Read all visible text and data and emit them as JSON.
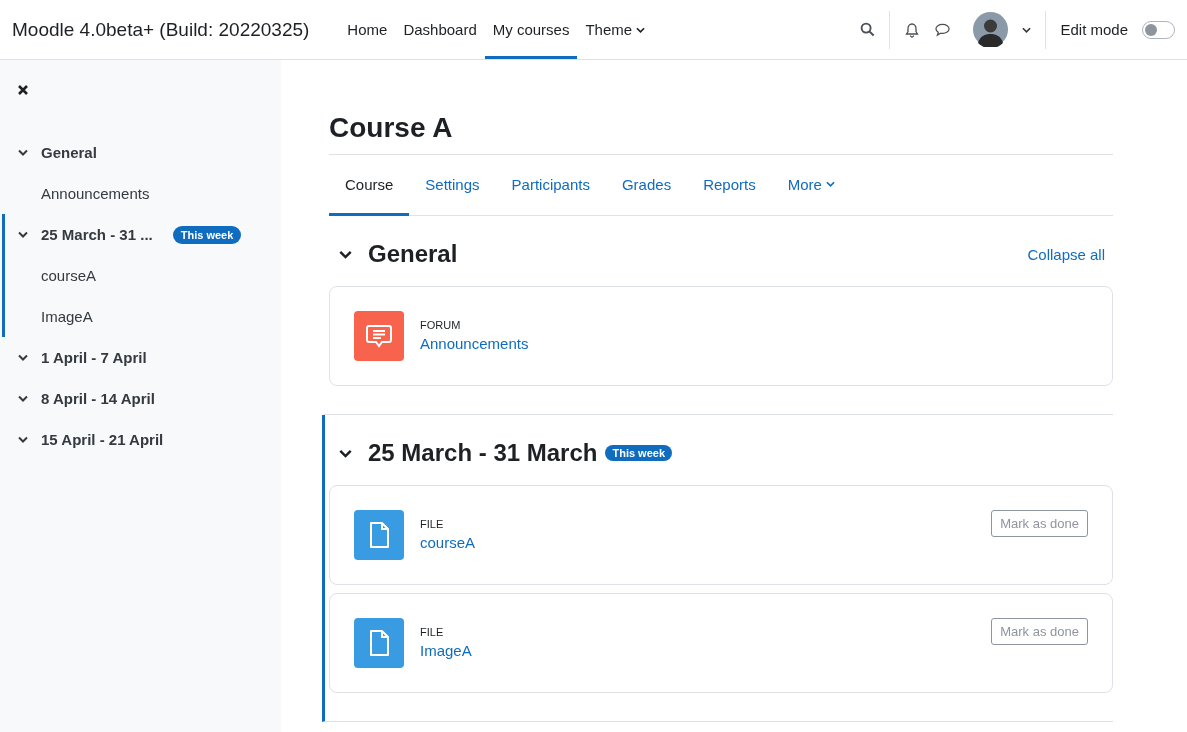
{
  "navbar": {
    "brand": "Moodle 4.0beta+ (Build: 20220325)",
    "items": [
      {
        "label": "Home",
        "kind": "link",
        "selected": false
      },
      {
        "label": "Dashboard",
        "kind": "link",
        "selected": false
      },
      {
        "label": "My courses",
        "kind": "link",
        "selected": true
      },
      {
        "label": "Theme",
        "kind": "dropdown",
        "selected": false
      }
    ],
    "edit_mode": {
      "label": "Edit mode",
      "on": false
    }
  },
  "sidebar": {
    "sections": [
      {
        "title": "General",
        "expanded": true,
        "current": false,
        "children": [
          {
            "label": "Announcements"
          }
        ]
      },
      {
        "title": "25 March - 31 ...",
        "badge": "This week",
        "expanded": true,
        "current": true,
        "children": [
          {
            "label": "courseA"
          },
          {
            "label": "ImageA"
          }
        ]
      },
      {
        "title": "1 April - 7 April",
        "expanded": true,
        "current": false
      },
      {
        "title": "8 April - 14 April",
        "expanded": true,
        "current": false
      },
      {
        "title": "15 April - 21 April",
        "expanded": true,
        "current": false
      }
    ]
  },
  "course": {
    "title": "Course A",
    "tabs": [
      {
        "label": "Course",
        "kind": "link",
        "selected": true
      },
      {
        "label": "Settings",
        "kind": "link",
        "selected": false
      },
      {
        "label": "Participants",
        "kind": "link",
        "selected": false
      },
      {
        "label": "Grades",
        "kind": "link",
        "selected": false
      },
      {
        "label": "Reports",
        "kind": "link",
        "selected": false
      },
      {
        "label": "More",
        "kind": "dropdown",
        "selected": false
      }
    ],
    "sections": [
      {
        "title": "General",
        "expanded": true,
        "current": false,
        "collapse_all": "Collapse all",
        "activities": [
          {
            "kind": "forum",
            "type": "FORUM",
            "name": "Announcements"
          }
        ]
      },
      {
        "title": "25 March - 31 March",
        "badge": "This week",
        "expanded": true,
        "current": true,
        "activities": [
          {
            "kind": "file",
            "type": "FILE",
            "name": "courseA",
            "button": "Mark as done"
          },
          {
            "kind": "file",
            "type": "FILE",
            "name": "ImageA",
            "button": "Mark as done"
          }
        ]
      }
    ]
  }
}
